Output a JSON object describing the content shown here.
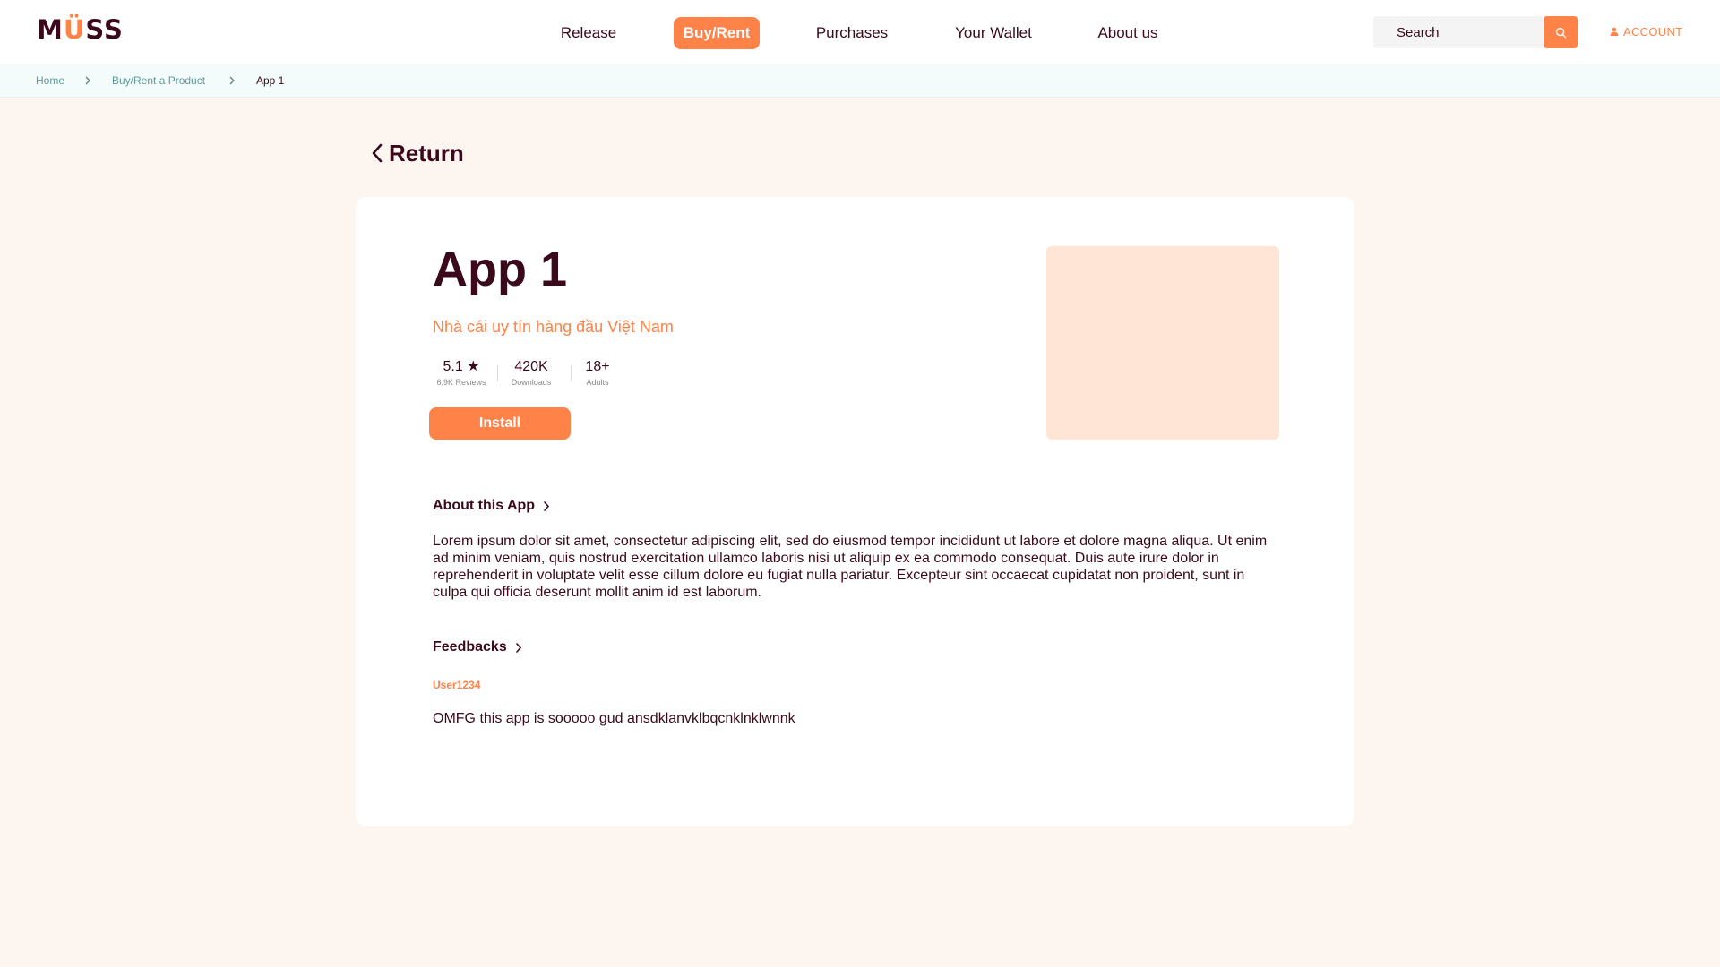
{
  "brand": {
    "logo_prefix": "M",
    "logo_u": "Ü",
    "logo_suffix": "SS",
    "accent_color": "#ff8248",
    "text_color": "#3a0a1c"
  },
  "nav": {
    "items": [
      {
        "label": "Release",
        "active": false
      },
      {
        "label": "Buy/Rent",
        "active": true
      },
      {
        "label": "Purchases",
        "active": false
      },
      {
        "label": "Your Wallet",
        "active": false
      },
      {
        "label": "About us",
        "active": false
      }
    ]
  },
  "search": {
    "placeholder": "Search",
    "value": "",
    "icon": "search-icon"
  },
  "account": {
    "label": "ACCOUNT",
    "icon": "user-icon"
  },
  "breadcrumb": {
    "items": [
      "Home",
      "Buy/Rent a Product",
      "App 1"
    ],
    "separator_icon": "chevron-right-icon"
  },
  "return_label": "Return",
  "app": {
    "title": "App 1",
    "subtitle": "Nhà cái uy tín hàng đầu Việt Nam",
    "stats": [
      {
        "value": "5.1 ★",
        "label": "6.9K Reviews"
      },
      {
        "value": "420K",
        "label": "Downloads"
      },
      {
        "value": "18+",
        "label": "Adults"
      }
    ],
    "install_label": "Install"
  },
  "about": {
    "heading": "About this App",
    "text": "Lorem ipsum dolor sit amet, consectetur adipiscing elit, sed do eiusmod tempor incididunt ut labore et dolore magna aliqua. Ut enim ad minim veniam, quis nostrud exercitation ullamco laboris nisi ut aliquip ex ea commodo consequat. Duis aute irure dolor in reprehenderit in voluptate velit esse cillum dolore eu fugiat nulla pariatur. Excepteur sint occaecat cupidatat non proident, sunt in culpa qui officia deserunt mollit anim id est laborum."
  },
  "feedbacks": {
    "heading": "Feedbacks",
    "items": [
      {
        "user": "User1234",
        "text": "OMFG this app is sooooo gud ansdklanvklbqcnklnklwnnk"
      }
    ]
  }
}
